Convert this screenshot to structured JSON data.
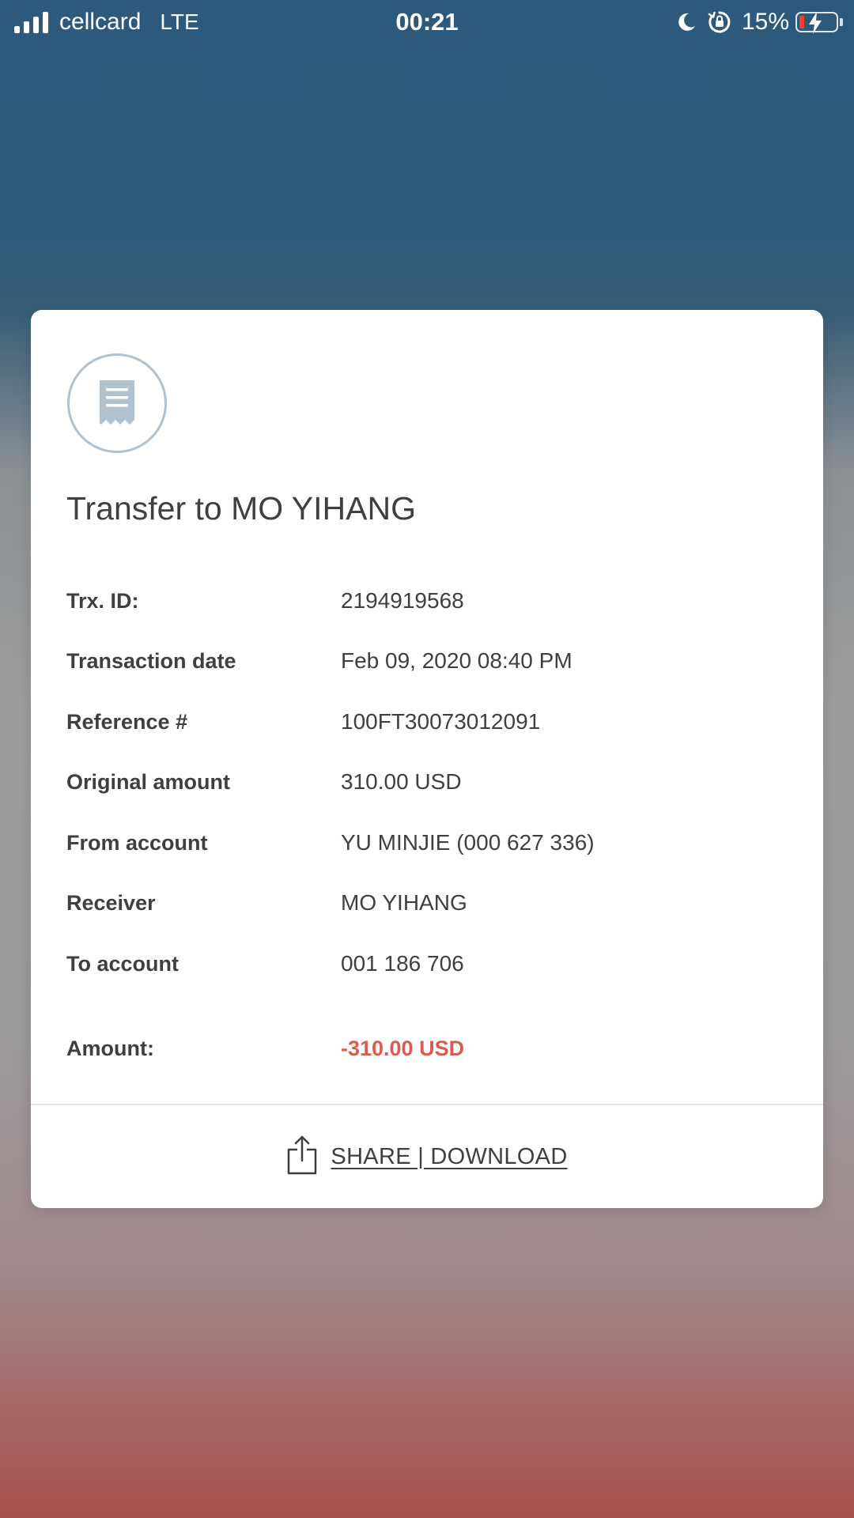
{
  "status_bar": {
    "carrier": "cellcard",
    "network": "LTE",
    "time": "00:21",
    "battery_percent": "15%",
    "icons": [
      "signal-bars-icon",
      "moon-icon",
      "rotation-lock-icon",
      "battery-charging-icon"
    ]
  },
  "receipt": {
    "icon": "receipt-icon",
    "title": "Transfer to MO YIHANG",
    "details": [
      {
        "label": "Trx. ID:",
        "value": "2194919568"
      },
      {
        "label": "Transaction date",
        "value": "Feb 09, 2020 08:40 PM"
      },
      {
        "label": "Reference #",
        "value": "100FT30073012091"
      },
      {
        "label": "Original amount",
        "value": "310.00 USD"
      },
      {
        "label": "From account",
        "value": "YU MINJIE (000 627 336)"
      },
      {
        "label": "Receiver",
        "value": "MO YIHANG"
      },
      {
        "label": "To account",
        "value": "001 186 706"
      }
    ],
    "amount": {
      "label": "Amount:",
      "value": "-310.00 USD"
    },
    "share_label": "SHARE | DOWNLOAD",
    "share_icon": "share-icon"
  },
  "colors": {
    "amount_negative": "#dc5b50",
    "text_primary": "#3f3f3f",
    "badge_outline": "#b1c1cd",
    "battery_low": "#ff3b30"
  }
}
